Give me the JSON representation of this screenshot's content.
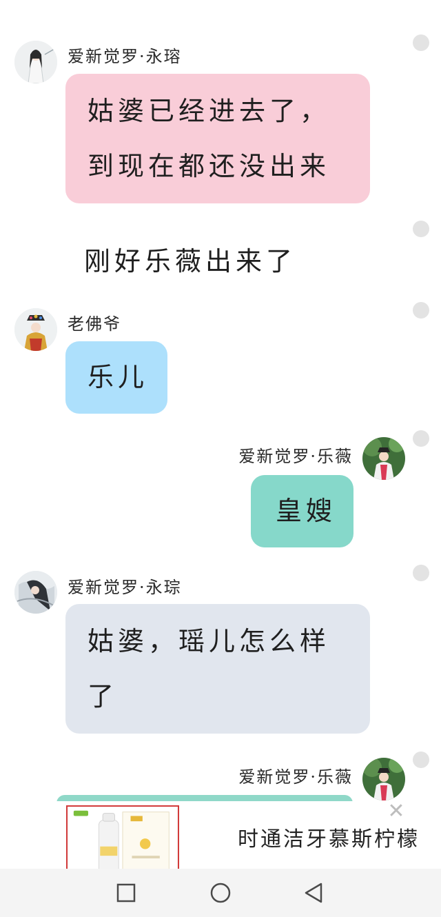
{
  "messages": [
    {
      "sender": "爱新觉罗·永瑢",
      "lines": [
        "姑婆已经进去了，",
        "到现在都还没出来"
      ],
      "bubble_color": "#f9cdd8",
      "side": "left"
    },
    {
      "text": "刚好乐薇出来了"
    },
    {
      "sender": "老佛爷",
      "lines": [
        "乐儿"
      ],
      "bubble_color": "#ade0fc",
      "side": "left"
    },
    {
      "sender": "爱新觉罗·乐薇",
      "lines": [
        "皇嫂"
      ],
      "bubble_color": "#86d8ca",
      "side": "right"
    },
    {
      "sender": "爱新觉罗·永琮",
      "lines": [
        "姑婆，瑶儿怎么样",
        "了"
      ],
      "bubble_color": "#e1e6ee",
      "side": "left"
    },
    {
      "sender": "爱新觉罗·乐薇",
      "side": "right"
    }
  ],
  "ad": {
    "title": "时通洁牙慕斯柠檬",
    "close_icon": "close-icon",
    "bar_color": "#8fd8c8"
  },
  "navbar": {
    "icons": [
      "recent-apps-icon",
      "home-icon",
      "back-icon"
    ]
  }
}
